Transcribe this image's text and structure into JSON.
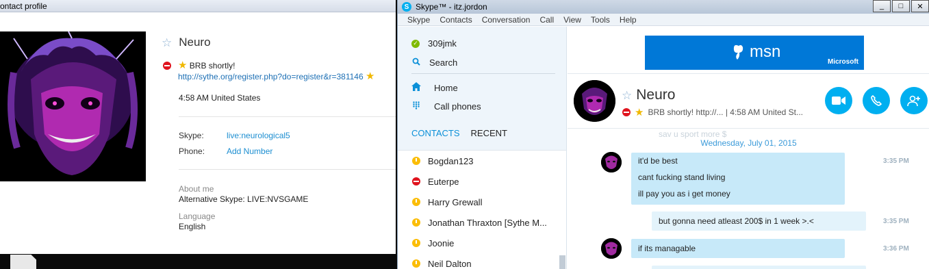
{
  "profile_window": {
    "title": "ontact profile",
    "name": "Neuro",
    "mood": "BRB shortly!",
    "mood_link": "http://sythe.org/register.php?do=register&r=381146",
    "local_time": "4:58 AM United States",
    "fields": [
      {
        "label": "Skype:",
        "value": "live:neurological5"
      },
      {
        "label": "Phone:",
        "value": "Add Number"
      }
    ],
    "about_label": "About me",
    "about_value": "Alternative Skype:  LIVE:NVSGAME",
    "language_label": "Language",
    "language_value": "English"
  },
  "skype_window": {
    "title": "Skype™ - itz.jordon",
    "window_buttons": [
      "_",
      "□",
      "✕"
    ],
    "menu": [
      "Skype",
      "Contacts",
      "Conversation",
      "Call",
      "View",
      "Tools",
      "Help"
    ],
    "left_panel": {
      "account": "309jmk",
      "search": "Search",
      "home": "Home",
      "call_phones": "Call phones",
      "tabs": {
        "contacts": "CONTACTS",
        "recent": "RECENT"
      },
      "contacts": [
        {
          "name": "Bogdan123",
          "status": "away"
        },
        {
          "name": "Euterpe",
          "status": "dnd"
        },
        {
          "name": "Harry Grewall",
          "status": "away"
        },
        {
          "name": "Jonathan Thraxton [Sythe M...",
          "status": "away"
        },
        {
          "name": "Joonie",
          "status": "away"
        },
        {
          "name": "Neil Dalton",
          "status": "away"
        }
      ]
    },
    "chat": {
      "ad": {
        "brand": "msn",
        "company": "Microsoft"
      },
      "contact_name": "Neuro",
      "status_line": "BRB shortly! http://...  | 4:58 AM United St...",
      "faded_text": "sav u sport more $",
      "date": "Wednesday, July 01, 2015",
      "messages": [
        {
          "lines": [
            "it'd be best",
            "cant fucking stand living",
            "ill pay you as i get money"
          ],
          "time": "3:35 PM",
          "direction": "in"
        },
        {
          "lines": [
            "but gonna need atleast 200$ in 1 week >.<"
          ],
          "time": "3:35 PM",
          "direction": "out"
        },
        {
          "lines": [
            "if its managable"
          ],
          "time": "3:36 PM",
          "direction": "in"
        }
      ]
    }
  },
  "colors": {
    "skype_blue": "#00aff0",
    "link_blue": "#1c8ed1",
    "bubble_in": "#c7e9f9",
    "bubble_out": "#e3f3fb",
    "msn_blue": "#0078d7"
  }
}
